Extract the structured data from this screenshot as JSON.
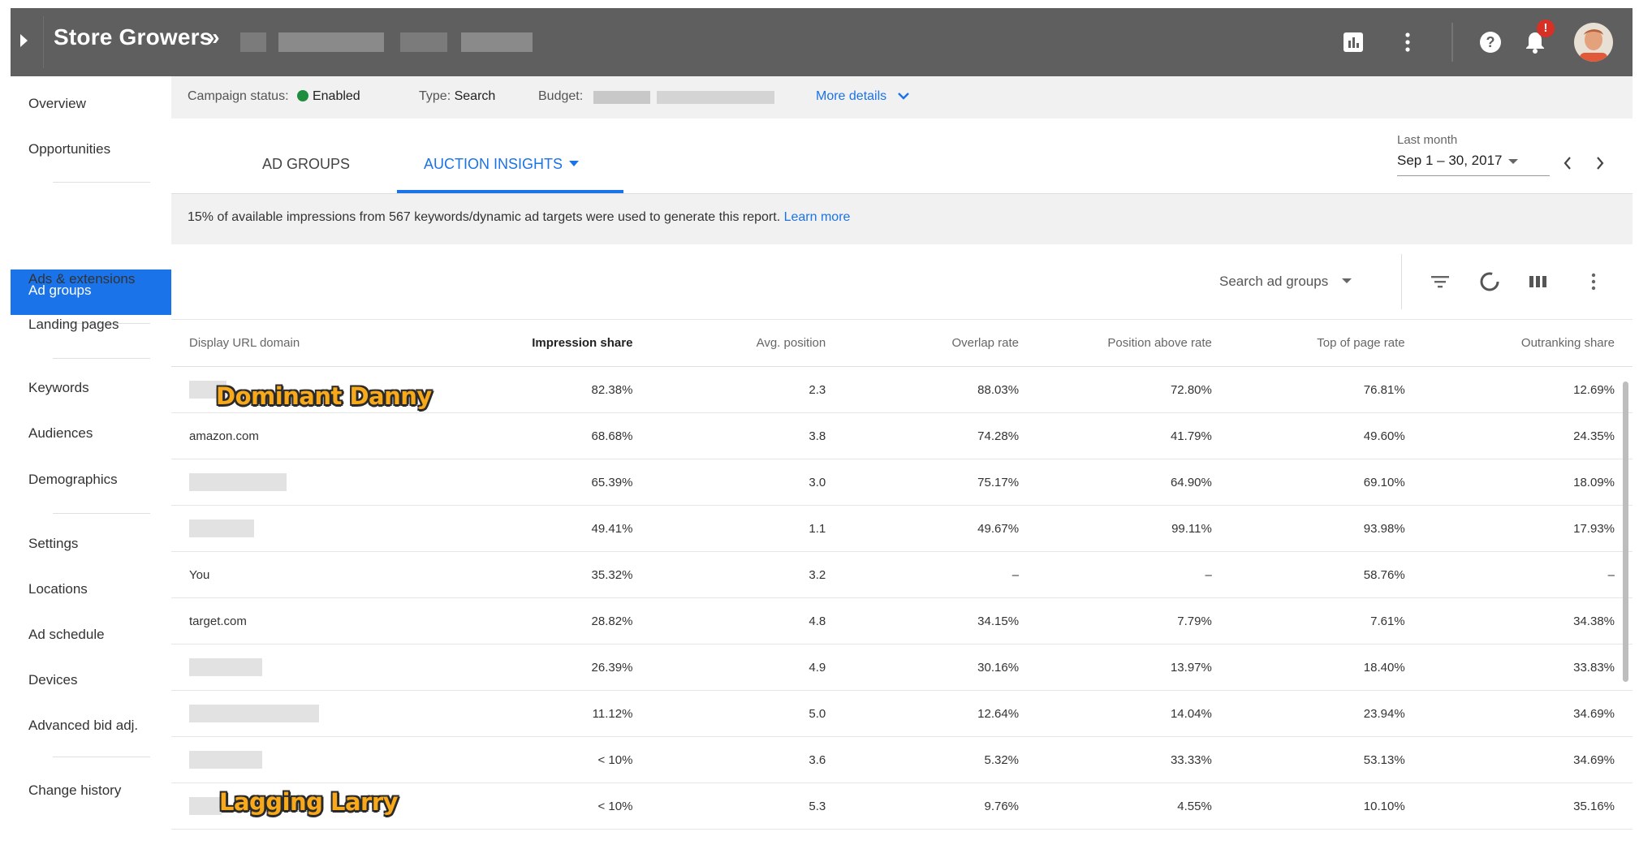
{
  "header": {
    "brand": "Store Growers",
    "breadcrumb_separator": "»",
    "icons": [
      "reports-icon",
      "more-vert-icon",
      "help-icon",
      "notifications-icon",
      "avatar"
    ],
    "notification_badge": "!",
    "colors": {
      "bar": "#5f5f5f",
      "badge": "#d93025"
    }
  },
  "sidebar": {
    "items": [
      {
        "label": "Overview"
      },
      {
        "label": "Opportunities"
      },
      {
        "label": "Ad groups",
        "active": true
      },
      {
        "label": "Ads & extensions"
      },
      {
        "label": "Landing pages"
      },
      {
        "label": "Keywords"
      },
      {
        "label": "Audiences"
      },
      {
        "label": "Demographics"
      },
      {
        "label": "Settings"
      },
      {
        "label": "Locations"
      },
      {
        "label": "Ad schedule"
      },
      {
        "label": "Devices"
      },
      {
        "label": "Advanced bid adj."
      },
      {
        "label": "Change history"
      }
    ]
  },
  "status": {
    "campaign_status_label": "Campaign status:",
    "campaign_status_value": "Enabled",
    "type_label": "Type:",
    "type_value": "Search",
    "budget_label": "Budget:",
    "more_details": "More details"
  },
  "tabs": {
    "ad_groups": "AD GROUPS",
    "auction_insights": "AUCTION INSIGHTS",
    "active": "auction_insights"
  },
  "date_range": {
    "label": "Last month",
    "value": "Sep 1 – 30, 2017"
  },
  "notice": {
    "text": "15% of available impressions from 567 keywords/dynamic ad targets were used to generate this report.",
    "link": "Learn more"
  },
  "toolbar": {
    "search_label": "Search ad groups",
    "icons": [
      "filter-icon",
      "segment-icon",
      "columns-icon",
      "more-vert-icon"
    ]
  },
  "table": {
    "columns": [
      "Display URL domain",
      "Impression share",
      "Avg. position",
      "Overlap rate",
      "Position above rate",
      "Top of page rate",
      "Outranking share"
    ],
    "rows": [
      [
        "",
        "82.38%",
        "2.3",
        "88.03%",
        "72.80%",
        "76.81%",
        "12.69%"
      ],
      [
        "amazon.com",
        "68.68%",
        "3.8",
        "74.28%",
        "41.79%",
        "49.60%",
        "24.35%"
      ],
      [
        "",
        "65.39%",
        "3.0",
        "75.17%",
        "64.90%",
        "69.10%",
        "18.09%"
      ],
      [
        "",
        "49.41%",
        "1.1",
        "49.67%",
        "99.11%",
        "93.98%",
        "17.93%"
      ],
      [
        "You",
        "35.32%",
        "3.2",
        "–",
        "–",
        "58.76%",
        "–"
      ],
      [
        "target.com",
        "28.82%",
        "4.8",
        "34.15%",
        "7.79%",
        "7.61%",
        "34.38%"
      ],
      [
        "",
        "26.39%",
        "4.9",
        "30.16%",
        "13.97%",
        "18.40%",
        "33.83%"
      ],
      [
        "",
        "11.12%",
        "5.0",
        "12.64%",
        "14.04%",
        "23.94%",
        "34.69%"
      ],
      [
        "",
        "< 10%",
        "3.6",
        "5.32%",
        "33.33%",
        "53.13%",
        "34.69%"
      ],
      [
        "",
        "< 10%",
        "5.3",
        "9.76%",
        "4.55%",
        "10.10%",
        "35.16%"
      ]
    ]
  },
  "annotations": {
    "top": "Dominant Danny",
    "bottom": "Lagging Larry"
  }
}
